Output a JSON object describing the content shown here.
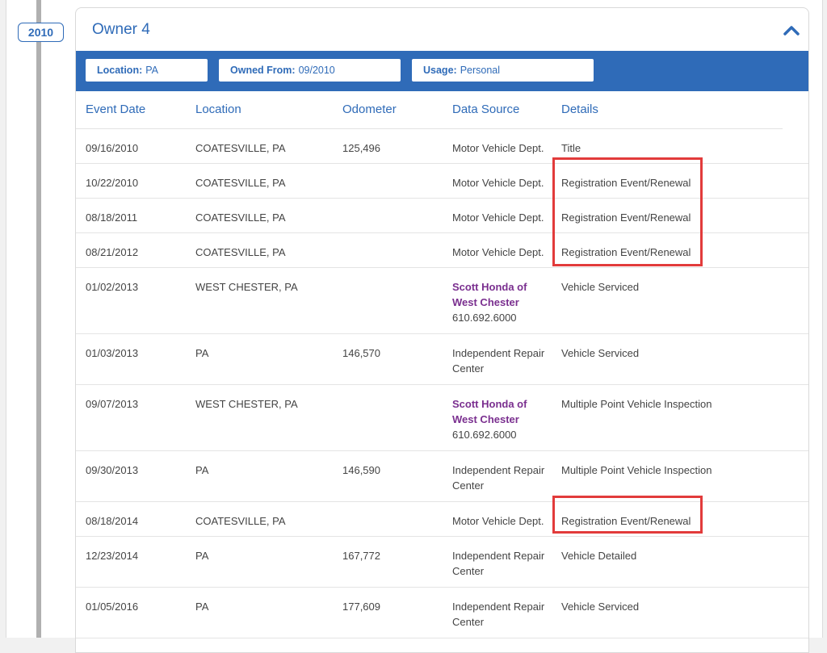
{
  "year_badge": "2010",
  "owner": {
    "title": "Owner 4",
    "location_label": "Location:",
    "location_value": "PA",
    "owned_label": "Owned From:",
    "owned_value": "09/2010",
    "usage_label": "Usage:",
    "usage_value": "Personal"
  },
  "table": {
    "headers": {
      "event_date": "Event Date",
      "location": "Location",
      "odometer": "Odometer",
      "data_source": "Data Source",
      "details": "Details"
    },
    "rows": [
      {
        "date": "09/16/2010",
        "location": "COATESVILLE, PA",
        "odometer": "125,496",
        "source": "Motor Vehicle Dept.",
        "details": "Title"
      },
      {
        "date": "10/22/2010",
        "location": "COATESVILLE, PA",
        "odometer": "",
        "source": "Motor Vehicle Dept.",
        "details": "Registration Event/Renewal"
      },
      {
        "date": "08/18/2011",
        "location": "COATESVILLE, PA",
        "odometer": "",
        "source": "Motor Vehicle Dept.",
        "details": "Registration Event/Renewal"
      },
      {
        "date": "08/21/2012",
        "location": "COATESVILLE, PA",
        "odometer": "",
        "source": "Motor Vehicle Dept.",
        "details": "Registration Event/Renewal"
      },
      {
        "date": "01/02/2013",
        "location": "WEST CHESTER, PA",
        "odometer": "",
        "source_dealer": "Scott Honda of West Chester",
        "source_phone": "610.692.6000",
        "details": "Vehicle Serviced"
      },
      {
        "date": "01/03/2013",
        "location": "PA",
        "odometer": "146,570",
        "source": "Independent Repair Center",
        "details": "Vehicle Serviced"
      },
      {
        "date": "09/07/2013",
        "location": "WEST CHESTER, PA",
        "odometer": "",
        "source_dealer": "Scott Honda of West Chester",
        "source_phone": "610.692.6000",
        "details": "Multiple Point Vehicle Inspection"
      },
      {
        "date": "09/30/2013",
        "location": "PA",
        "odometer": "146,590",
        "source": "Independent Repair Center",
        "details": "Multiple Point Vehicle Inspection"
      },
      {
        "date": "08/18/2014",
        "location": "COATESVILLE, PA",
        "odometer": "",
        "source": "Motor Vehicle Dept.",
        "details": "Registration Event/Renewal"
      },
      {
        "date": "12/23/2014",
        "location": "PA",
        "odometer": "167,772",
        "source": "Independent Repair Center",
        "details": "Vehicle Detailed"
      },
      {
        "date": "01/05/2016",
        "location": "PA",
        "odometer": "177,609",
        "source": "Independent Repair Center",
        "details": "Vehicle Serviced"
      }
    ]
  },
  "icons": {
    "collapse": "chevron-up-icon"
  },
  "colors": {
    "accent": "#2f6bb8",
    "dealer": "#7a2f8f",
    "highlight": "#e23b3b"
  }
}
